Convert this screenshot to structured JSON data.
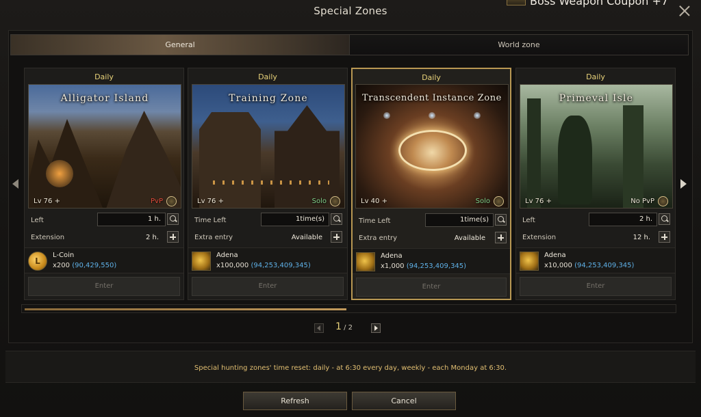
{
  "window": {
    "title": "Special Zones",
    "coupon_text": "Boss Weapon Coupon +7"
  },
  "tabs": [
    {
      "label": "General",
      "active": true
    },
    {
      "label": "World zone",
      "active": false
    }
  ],
  "cards": [
    {
      "period": "Daily",
      "name": "Alligator Island",
      "level": "Lv 76 +",
      "mode": "PvP",
      "row1_label": "Left",
      "row1_value": "1 h.",
      "row2_label": "Extension",
      "row2_value": "2 h.",
      "cost_name": "L-Coin",
      "cost_qty": "x200",
      "cost_own": "(90,429,550)",
      "enter": "Enter"
    },
    {
      "period": "Daily",
      "name": "Training Zone",
      "level": "Lv 76 +",
      "mode": "Solo",
      "row1_label": "Time Left",
      "row1_value": "1time(s)",
      "row2_label": "Extra entry",
      "row2_value": "Available",
      "cost_name": "Adena",
      "cost_qty": "x100,000",
      "cost_own": "(94,253,409,345)",
      "enter": "Enter"
    },
    {
      "period": "Daily",
      "name": "Transcendent Instance Zone",
      "level": "Lv 40 +",
      "mode": "Solo",
      "row1_label": "Time Left",
      "row1_value": "1time(s)",
      "row2_label": "Extra entry",
      "row2_value": "Available",
      "cost_name": "Adena",
      "cost_qty": "x1,000",
      "cost_own": "(94,253,409,345)",
      "enter": "Enter"
    },
    {
      "period": "Daily",
      "name": "Primeval Isle",
      "level": "Lv 76 +",
      "mode": "No PvP",
      "row1_label": "Left",
      "row1_value": "2 h.",
      "row2_label": "Extension",
      "row2_value": "12 h.",
      "cost_name": "Adena",
      "cost_qty": "x10,000",
      "cost_own": "(94,253,409,345)",
      "enter": "Enter"
    }
  ],
  "pager": {
    "current": "1",
    "total": "/ 2"
  },
  "notice": "Special hunting zones' time reset: daily - at 6:30 every day, weekly - each Monday at 6:30.",
  "buttons": {
    "refresh": "Refresh",
    "cancel": "Cancel"
  },
  "coin_letter": "L",
  "colors": {
    "accent": "#b99853",
    "pvp": "#e04a3a",
    "solo": "#7fd08a",
    "owned": "#5fb1e8",
    "notice": "#e2bf72"
  }
}
